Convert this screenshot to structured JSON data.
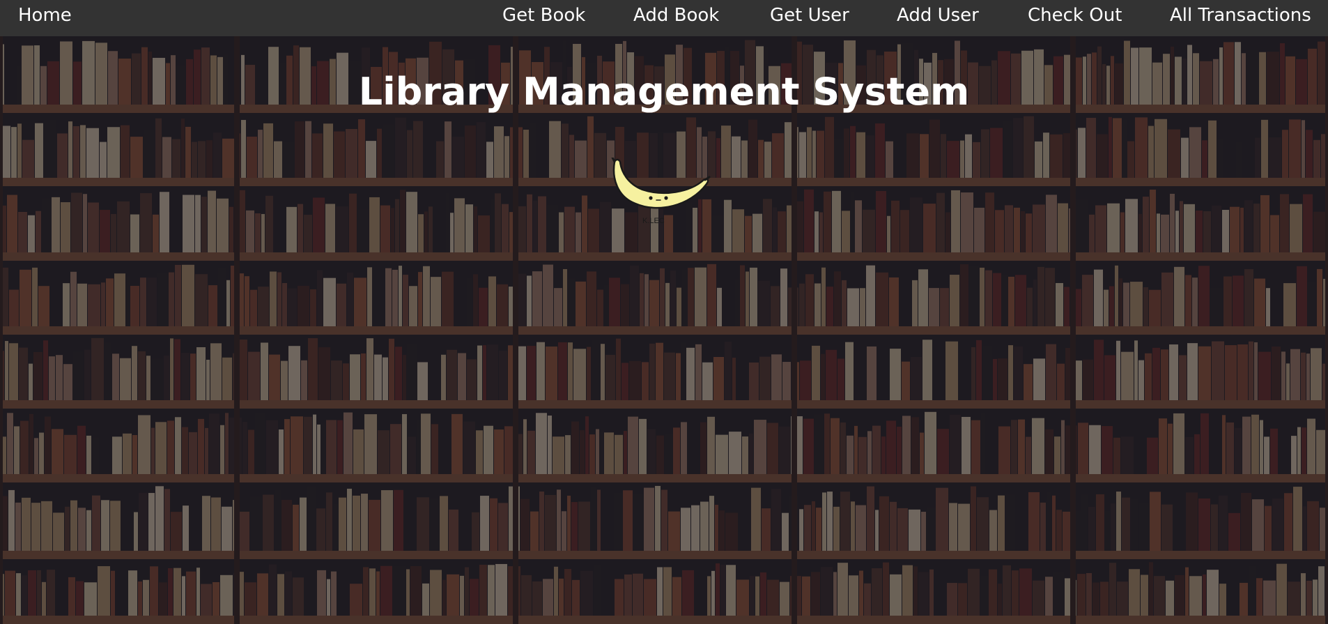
{
  "nav": {
    "home": "Home",
    "get_book": "Get Book",
    "add_book": "Add Book",
    "get_user": "Get User",
    "add_user": "Add User",
    "check_out": "Check Out",
    "all_transactions": "All Transactions"
  },
  "main": {
    "title": "Library Management System",
    "logo_icon": "banana-icon",
    "logo_signature": "K.LEC"
  },
  "colors": {
    "navbar": "#333333",
    "nav_text": "#ffffff",
    "title_text": "#ffffff",
    "banana": "#f6f1a0"
  }
}
